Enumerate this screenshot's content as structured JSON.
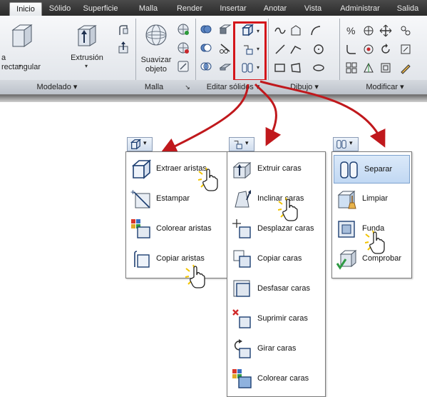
{
  "tabs": [
    "Inicio",
    "Sólido",
    "Superficie",
    "Malla",
    "Render",
    "Insertar",
    "Anotar",
    "Vista",
    "Administrar",
    "Salida"
  ],
  "ribbon": {
    "box_label": "a rectangular",
    "extrude_label": "Extrusión",
    "smooth_label_1": "Suavizar",
    "smooth_label_2": "objeto",
    "panels": {
      "modelado": "Modelado ▾",
      "malla": "Malla",
      "malla_launcher": "↘",
      "editar": "Editar sólidos ▾",
      "dibujo": "Dibujo ▾",
      "modificar": "Modificar ▾"
    }
  },
  "flyouts": {
    "edges": {
      "items": [
        {
          "label": "Extraer aristas",
          "icon": "extract-edges-icon"
        },
        {
          "label": "Estampar",
          "icon": "imprint-icon"
        },
        {
          "label": "Colorear aristas",
          "icon": "color-edges-icon"
        },
        {
          "label": "Copiar aristas",
          "icon": "copy-edges-icon"
        }
      ]
    },
    "faces": {
      "items": [
        {
          "label": "Extruir caras",
          "icon": "extrude-faces-icon"
        },
        {
          "label": "Inclinar caras",
          "icon": "taper-faces-icon"
        },
        {
          "label": "Desplazar caras",
          "icon": "move-faces-icon"
        },
        {
          "label": "Copiar caras",
          "icon": "copy-faces-icon"
        },
        {
          "label": "Desfasar caras",
          "icon": "offset-faces-icon"
        },
        {
          "label": "Suprimir caras",
          "icon": "delete-faces-icon"
        },
        {
          "label": "Girar caras",
          "icon": "rotate-faces-icon"
        },
        {
          "label": "Colorear caras",
          "icon": "color-faces-icon"
        }
      ]
    },
    "body": {
      "items": [
        {
          "label": "Separar",
          "icon": "separate-icon"
        },
        {
          "label": "Limpiar",
          "icon": "clean-icon"
        },
        {
          "label": "Funda",
          "icon": "shell-icon"
        },
        {
          "label": "Comprobar",
          "icon": "check-icon"
        }
      ]
    }
  },
  "colors": {
    "highlight": "#d4161b",
    "arrow": "#c0181c",
    "selected_bg": "#c1d8f3"
  }
}
